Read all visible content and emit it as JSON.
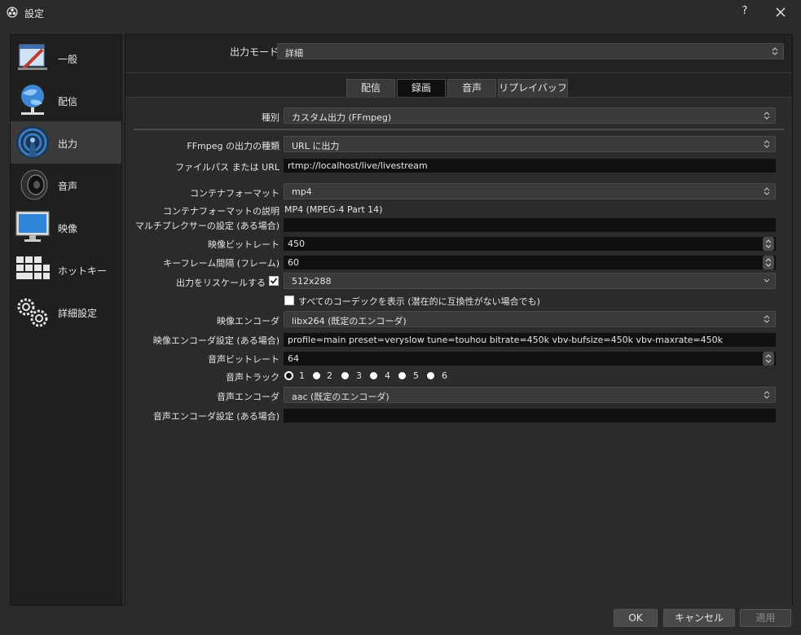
{
  "window": {
    "title": "設定",
    "help": "?"
  },
  "sidebar": {
    "items": [
      {
        "label": "一般",
        "icon": "general-icon"
      },
      {
        "label": "配信",
        "icon": "globe-network-icon"
      },
      {
        "label": "出力",
        "icon": "broadcast-antenna-icon",
        "active": true
      },
      {
        "label": "音声",
        "icon": "speaker-icon"
      },
      {
        "label": "映像",
        "icon": "monitor-icon"
      },
      {
        "label": "ホットキー",
        "icon": "keyboard-icon"
      },
      {
        "label": "詳細設定",
        "icon": "gears-icon"
      }
    ]
  },
  "output_mode": {
    "label": "出力モード",
    "value": "詳細"
  },
  "tabs": [
    {
      "label": "配信"
    },
    {
      "label": "録画",
      "active": true
    },
    {
      "label": "音声"
    },
    {
      "label": "リプレイバッファー"
    }
  ],
  "recording": {
    "type_label": "種別",
    "type_value": "カスタム出力 (FFmpeg)",
    "ffmpeg_type_label": "FFmpeg の出力の種類",
    "ffmpeg_type_value": "URL に出力",
    "path_label": "ファイルパス または URL",
    "path_value": "rtmp://localhost/live/livestream",
    "container_label": "コンテナフォーマット",
    "container_value": "mp4",
    "container_desc_label": "コンテナフォーマットの説明",
    "container_desc_value": "MP4 (MPEG-4 Part 14)",
    "muxer_label": "マルチプレクサーの設定 (ある場合)",
    "muxer_value": "",
    "video_bitrate_label": "映像ビットレート",
    "video_bitrate_value": "450",
    "keyframe_label": "キーフレーム間隔 (フレーム)",
    "keyframe_value": "60",
    "rescale_label": "出力をリスケールする",
    "rescale_value": "512x288",
    "rescale_checked": true,
    "show_all_codecs_label": "すべてのコーデックを表示 (潜在的に互換性がない場合でも)",
    "show_all_codecs_checked": false,
    "video_encoder_label": "映像エンコーダ",
    "video_encoder_value": "libx264 (既定のエンコーダ)",
    "video_encoder_settings_label": "映像エンコーダ設定 (ある場合)",
    "video_encoder_settings_value": "profile=main preset=veryslow tune=touhou bitrate=450k vbv-bufsize=450k vbv-maxrate=450k",
    "audio_bitrate_label": "音声ビットレート",
    "audio_bitrate_value": "64",
    "audio_track_label": "音声トラック",
    "audio_tracks": [
      {
        "label": "1",
        "selected": true
      },
      {
        "label": "2",
        "selected": false
      },
      {
        "label": "3",
        "selected": false
      },
      {
        "label": "4",
        "selected": false
      },
      {
        "label": "5",
        "selected": false
      },
      {
        "label": "6",
        "selected": false
      }
    ],
    "audio_encoder_label": "音声エンコーダ",
    "audio_encoder_value": "aac (既定のエンコーダ)",
    "audio_encoder_settings_label": "音声エンコーダ設定 (ある場合)",
    "audio_encoder_settings_value": ""
  },
  "buttons": {
    "ok": "OK",
    "cancel": "キャンセル",
    "apply": "適用"
  }
}
